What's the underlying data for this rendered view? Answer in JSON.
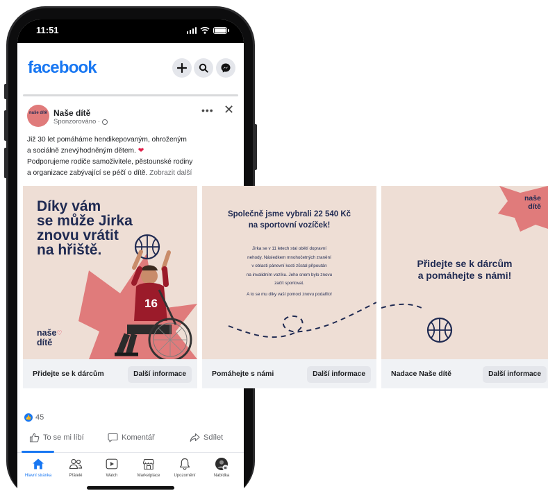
{
  "status": {
    "time": "11:51"
  },
  "header": {
    "logo": "facebook",
    "buttons": [
      "plus-icon",
      "search-icon",
      "messenger-icon"
    ]
  },
  "post": {
    "page_name": "Naše dítě",
    "avatar_text": "naše dítě",
    "sponsored": "Sponzorováno ·",
    "text_line1": "Již 30 let pomáháme hendikepovaným, ohroženým",
    "text_line2": "a sociálně znevýhodněným dětem.",
    "text_line3": "Podporujeme rodiče samoživitele, pěstounské rodiny",
    "text_line4": "a organizace zabývající se péčí o dítě.",
    "see_more": "Zobrazit další"
  },
  "cards": [
    {
      "headline_1": "Díky vám",
      "headline_2": "se může Jirka",
      "headline_3": "znovu vrátit",
      "headline_4": "na hřiště.",
      "logo_1": "naše",
      "logo_2": "dítě",
      "jersey_number": "16",
      "title": "Přidejte se k dárcům",
      "button": "Další informace"
    },
    {
      "headline_1": "Společně jsme vybrali 22 540 Kč",
      "headline_2": "na sportovní vozíček!",
      "body_1": "Jirka se v 11 letech stal obětí dopravní",
      "body_2": "nehody. Následkem mnohočetných zranění",
      "body_3": "v oblasti pánevní kosti zůstal připoután",
      "body_4": "na invalidním vozíku. Jeho snem bylo znovu",
      "body_5": "začít sportovat.",
      "body_last": "A to se mu díky vaší pomoci znovu podařilo!",
      "title": "Pomáhejte s námi",
      "button": "Další informace"
    },
    {
      "logo_1": "naše",
      "logo_2": "dítě",
      "headline_1": "Přidejte se k dárcům",
      "headline_2": "a pomáhejte s námi!",
      "title": "Nadace Naše dítě",
      "button": "Další informace"
    }
  ],
  "engagement": {
    "likes": "45",
    "like": "To se mi líbí",
    "comment": "Komentář",
    "share": "Sdílet"
  },
  "nav": [
    {
      "label": "Hlavní stránka",
      "icon": "home-icon"
    },
    {
      "label": "Přátelé",
      "icon": "friends-icon"
    },
    {
      "label": "Watch",
      "icon": "watch-icon"
    },
    {
      "label": "Marketplace",
      "icon": "marketplace-icon"
    },
    {
      "label": "Upozornění",
      "icon": "bell-icon"
    },
    {
      "label": "Nabídka",
      "icon": "menu-avatar-icon"
    }
  ],
  "colors": {
    "fb_blue": "#1877f2",
    "card_bg": "#eeded5",
    "brand_pink": "#e07b7b",
    "brand_navy": "#1f2a52"
  }
}
